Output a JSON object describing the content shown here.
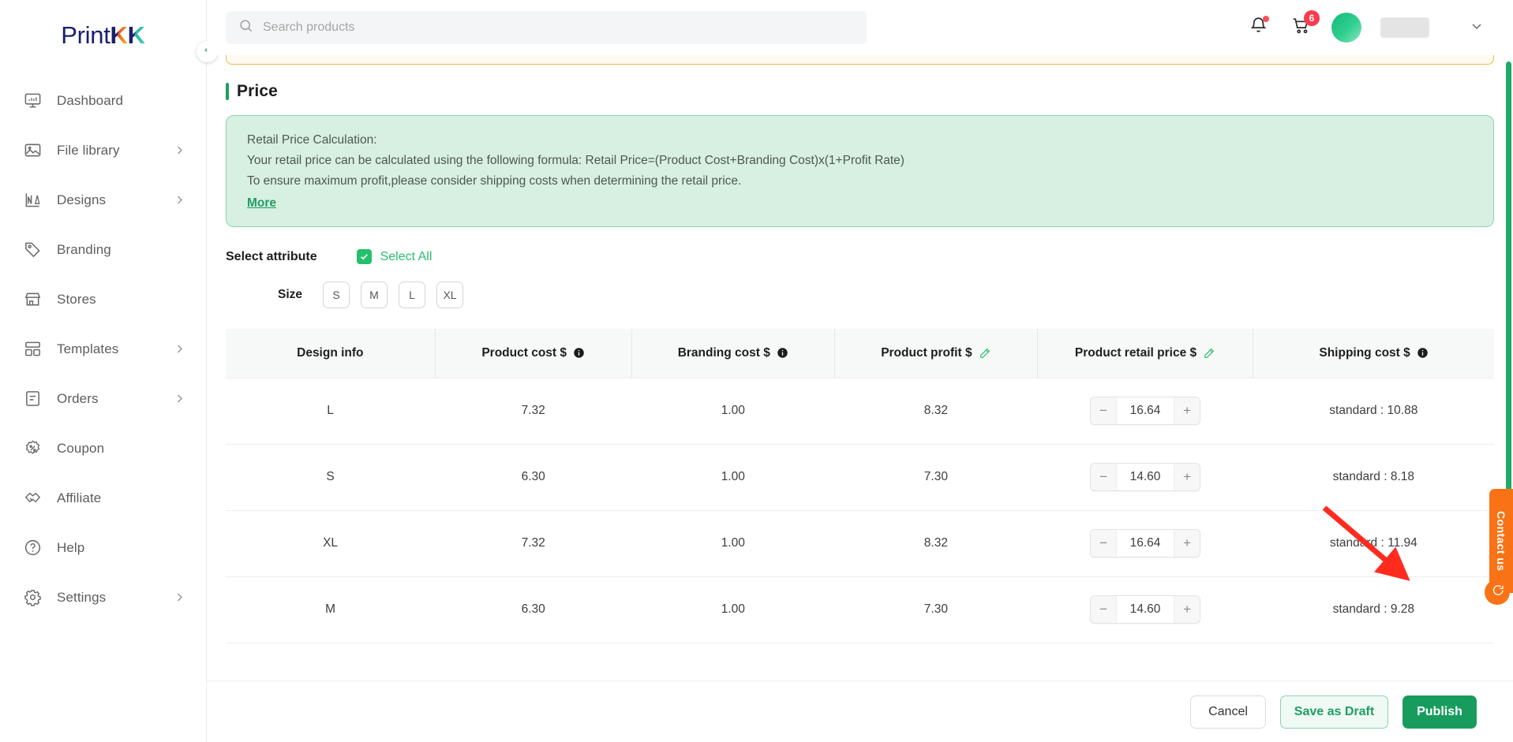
{
  "brand": {
    "name_part1": "Print",
    "name_part2": "K",
    "name_part3": "K"
  },
  "sidebar": {
    "items": [
      {
        "label": "Dashboard",
        "icon": "dashboard-icon",
        "has_chevron": false
      },
      {
        "label": "File library",
        "icon": "image-icon",
        "has_chevron": true
      },
      {
        "label": "Designs",
        "icon": "design-icon",
        "has_chevron": true
      },
      {
        "label": "Branding",
        "icon": "tag-icon",
        "has_chevron": false
      },
      {
        "label": "Stores",
        "icon": "store-icon",
        "has_chevron": false
      },
      {
        "label": "Templates",
        "icon": "templates-icon",
        "has_chevron": true
      },
      {
        "label": "Orders",
        "icon": "orders-icon",
        "has_chevron": true
      },
      {
        "label": "Coupon",
        "icon": "coupon-percent-icon",
        "has_chevron": false
      },
      {
        "label": "Affiliate",
        "icon": "handshake-icon",
        "has_chevron": false
      },
      {
        "label": "Help",
        "icon": "question-circle-icon",
        "has_chevron": false
      },
      {
        "label": "Settings",
        "icon": "gear-icon",
        "has_chevron": true
      }
    ],
    "collapse_icon": "chevron-left-icon"
  },
  "header": {
    "search": {
      "placeholder": "Search products",
      "value": "",
      "icon": "search-icon"
    },
    "notification_icon": "bell-icon",
    "notification_has_dot": true,
    "cart_icon": "cart-icon",
    "cart_badge": "6",
    "avatar": "avatar",
    "user_menu_icon": "chevron-down-icon"
  },
  "page": {
    "section_title": "Price",
    "info": {
      "line1": "Retail Price Calculation:",
      "line2": "Your retail price can be calculated using the following formula: Retail Price=(Product Cost+Branding Cost)x(1+Profit Rate)",
      "line3": "To ensure maximum profit,please consider shipping costs when determining the retail price.",
      "more_label": "More"
    },
    "attribute": {
      "label": "Select attribute",
      "select_all_label": "Select All",
      "select_all_checked": true,
      "size_label": "Size",
      "sizes": [
        "S",
        "M",
        "L",
        "XL"
      ]
    },
    "table": {
      "columns": [
        {
          "label": "Design info",
          "icon": ""
        },
        {
          "label": "Product cost $",
          "icon": "info-icon"
        },
        {
          "label": "Branding cost $",
          "icon": "info-icon"
        },
        {
          "label": "Product profit $",
          "icon": "edit-icon"
        },
        {
          "label": "Product retail price $",
          "icon": "edit-icon"
        },
        {
          "label": "Shipping cost $",
          "icon": "info-icon"
        }
      ],
      "rows": [
        {
          "design": "L",
          "product_cost": "7.32",
          "branding_cost": "1.00",
          "profit": "8.32",
          "retail": "16.64",
          "shipping": "standard : 10.88"
        },
        {
          "design": "S",
          "product_cost": "6.30",
          "branding_cost": "1.00",
          "profit": "7.30",
          "retail": "14.60",
          "shipping": "standard : 8.18"
        },
        {
          "design": "XL",
          "product_cost": "7.32",
          "branding_cost": "1.00",
          "profit": "8.32",
          "retail": "16.64",
          "shipping": "standard : 11.94"
        },
        {
          "design": "M",
          "product_cost": "6.30",
          "branding_cost": "1.00",
          "profit": "7.30",
          "retail": "14.60",
          "shipping": "standard : 9.28"
        }
      ],
      "stepper_minus": "−",
      "stepper_plus": "+"
    },
    "footer": {
      "cancel_label": "Cancel",
      "draft_label": "Save as Draft",
      "publish_label": "Publish"
    }
  },
  "widgets": {
    "contact_label": "Contact us",
    "contact_bubble_icon": "chat-icon"
  },
  "colors": {
    "brand_green": "#189c5e",
    "accent_green": "#2bbd72",
    "info_bg": "#d8f0e2",
    "warn_border": "#f3b84a",
    "badge_red": "#fb3b4e",
    "contact_orange": "#f97316"
  }
}
